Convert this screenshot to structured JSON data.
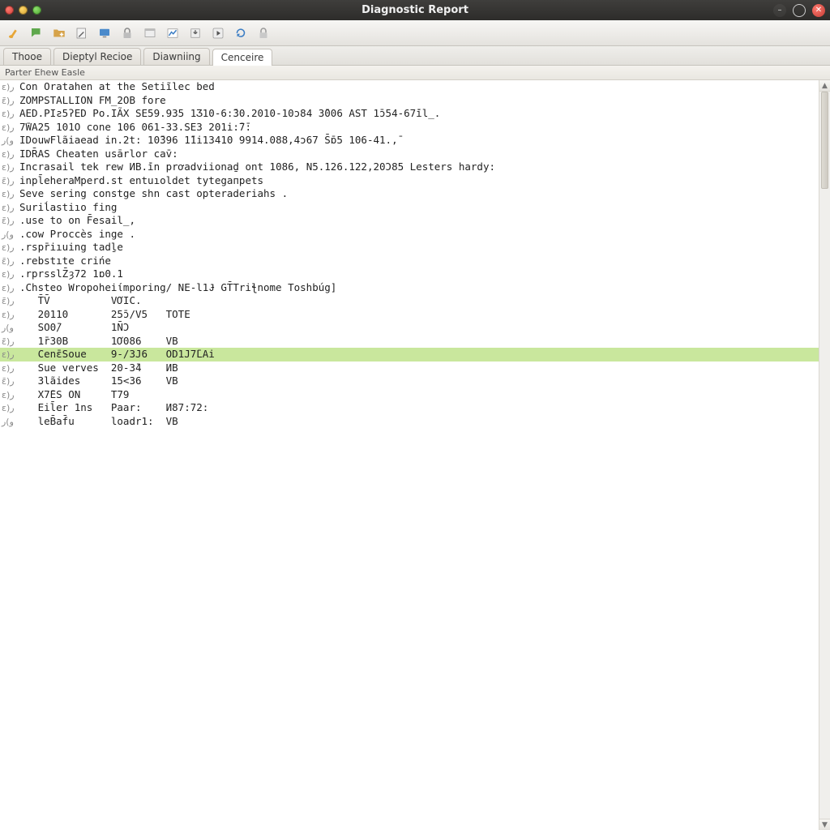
{
  "title": "Diagnostic Report",
  "tabs": [
    {
      "label": "Thooe",
      "active": false
    },
    {
      "label": "Dieptyl Recioe",
      "active": false
    },
    {
      "label": "Diawniing",
      "active": false
    },
    {
      "label": "Cenceire",
      "active": true
    }
  ],
  "breadcrumb": "Parter Ehew  Easle",
  "gutter_glyph_a": "ɛ)ر",
  "gutter_glyph_b": "ɛ̄)ر",
  "gutter_glyph_c": "و)ر",
  "log_lines": [
    "Con Oratahen at the Setiĩlec bed",
    "ZOMPSTALLION FM_2OB fore",
    "AED.PIƨ5ʔED Po.IÃX SE59.935 1Ʒ10-6:̄30.2010-10ͻ84 3̄006 AST 1ɔ̄54-67̄il_.",
    "7̄WA25 101O cone 106 061-33.SE3 201i:̄7̄:",
    "IDouwFlãiaead in.2t: 10̄396 1̄1i13410 9914.088,4ͻ67 S̄ɒ̄5 106-41.,̄",
    "IDR̄AS Cheaten usārlor cav̄:",
    "Incrasail tek rew ͶB.̄in prơadviionaḏ ont 1086, N5.126.122,20Ͻ85 Lesters hardy:",
    "inpl̄eheraMperd.st entuıoldet tytegaпpets",
    "Seve sering constge shn cast opteraderiahs .",
    "Suriĺastiıo fing",
    ".use to on F̄esail_,",
    ".cow Proccès inge .",
    ".rspr̄iıuing tadḻe",
    ".rebstıte crińe",
    ".rprsslZ̄ȝ72 1ɒ0.1",
    ".Chsteo Wropohei̇ίmporing/ NE-l1Ɉ GT̄Triꞎnome Toshbúg]",
    "   T̄V̄          VƠIC.",
    "   20110       25ɔ̄/V5   TOTE",
    "   SO0̄/        1N̄Ɔ",
    "   1r̄30B       1Ơ086    VB",
    "   Cenɛ̄Soue    9-/3J6   OD1J7̄LAi",
    "   Sue verves  20-3̄4    ͶB",
    "   3lãides     15<36    VB",
    "   X7̄ES ON     T79",
    "   Eil̄er 1ns   Paar:    Ͷ87:72:",
    "   leB̄af̄u      loadr1:  VB"
  ],
  "highlight_index": 20,
  "toolbar_icons": [
    "brush-icon",
    "chat-icon",
    "folder-plus-icon",
    "edit-icon",
    "monitor-icon",
    "lock-icon",
    "window-icon",
    "chart-icon",
    "export-icon",
    "play-icon",
    "refresh-icon",
    "lock2-icon"
  ],
  "window_buttons": {
    "min": "–",
    "max": "○",
    "close": "✕"
  }
}
